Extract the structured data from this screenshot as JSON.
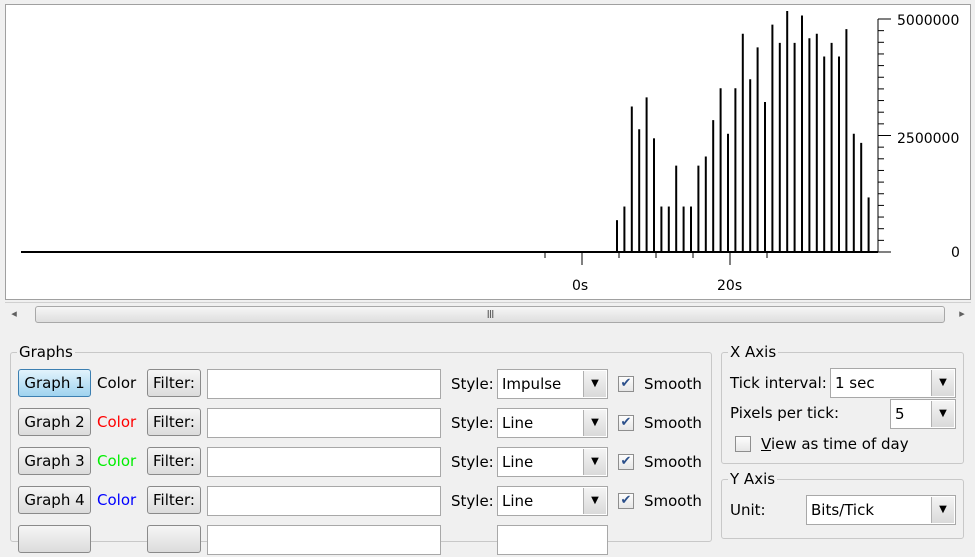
{
  "plot": {
    "y_ticks": [
      "5000000",
      "2500000",
      "0"
    ],
    "x_ticks": [
      "0s",
      "20s"
    ],
    "impulse_values": [
      700000,
      1000000,
      3200000,
      2700000,
      3400000,
      2500000,
      1000000,
      1000000,
      1900000,
      1000000,
      1000000,
      1900000,
      2100000,
      2900000,
      3600000,
      2600000,
      3600000,
      4800000,
      3800000,
      4500000,
      3300000,
      5000000,
      4600000,
      5300000,
      4600000,
      5200000,
      4700000,
      4800000,
      4300000,
      4600000,
      4300000,
      4900000,
      2600000,
      2400000,
      1200000
    ],
    "impulse_color": "#000000"
  },
  "scrollbar": {
    "left_arrow": "◂",
    "right_arrow": "▸",
    "grip": "III"
  },
  "graphs": {
    "title": "Graphs",
    "rows": [
      {
        "button": "Graph 1",
        "color_label": "Color",
        "color": "#000000",
        "filter_button": "Filter:",
        "filter_value": "",
        "style_label": "Style:",
        "style": "Impulse",
        "smooth_label": "Smooth",
        "smooth_checked": "✔",
        "active": true
      },
      {
        "button": "Graph 2",
        "color_label": "Color",
        "color": "#ff0000",
        "filter_button": "Filter:",
        "filter_value": "",
        "style_label": "Style:",
        "style": "Line",
        "smooth_label": "Smooth",
        "smooth_checked": "✔",
        "active": false
      },
      {
        "button": "Graph 3",
        "color_label": "Color",
        "color": "#00ee00",
        "filter_button": "Filter:",
        "filter_value": "",
        "style_label": "Style:",
        "style": "Line",
        "smooth_label": "Smooth",
        "smooth_checked": "✔",
        "active": false
      },
      {
        "button": "Graph 4",
        "color_label": "Color",
        "color": "#0000ff",
        "filter_button": "Filter:",
        "filter_value": "",
        "style_label": "Style:",
        "style": "Line",
        "smooth_label": "Smooth",
        "smooth_checked": "✔",
        "active": false
      }
    ]
  },
  "x_axis": {
    "title": "X Axis",
    "tick_interval_label": "Tick interval:",
    "tick_interval_value": "1 sec",
    "pixels_per_tick_label": "Pixels per tick:",
    "pixels_per_tick_value": "5",
    "view_time_of_day_label": "View as time of day",
    "view_time_of_day_checked": ""
  },
  "y_axis": {
    "title": "Y Axis",
    "unit_label": "Unit:",
    "unit_value": "Bits/Tick"
  },
  "icons": {
    "dropdown": "▼"
  }
}
